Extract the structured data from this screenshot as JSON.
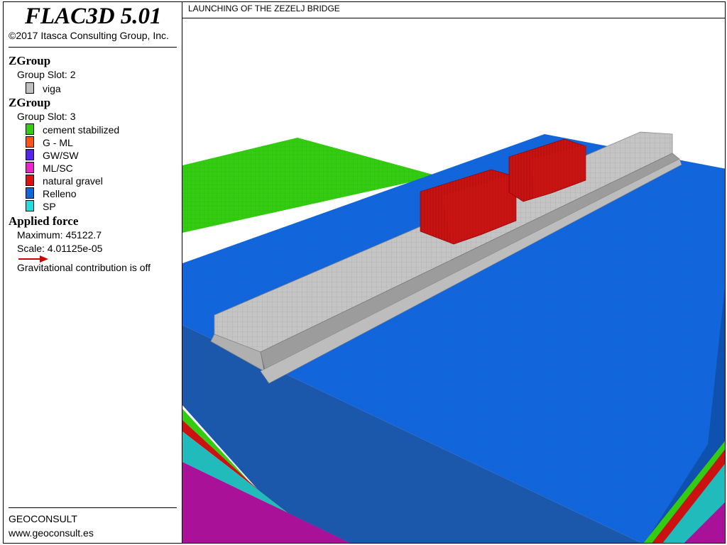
{
  "header": {
    "app_title": "FLAC3D 5.01",
    "copyright": "©2017 Itasca Consulting Group, Inc."
  },
  "legend": {
    "group1": {
      "heading": "ZGroup",
      "slot": "Group Slot: 2",
      "items": [
        {
          "label": "viga",
          "color": "#c0c0c0"
        }
      ]
    },
    "group2": {
      "heading": "ZGroup",
      "slot": "Group Slot: 3",
      "items": [
        {
          "label": "cement stabilized",
          "color": "#33cc11"
        },
        {
          "label": "G - ML",
          "color": "#ff5511"
        },
        {
          "label": "GW/SW",
          "color": "#5522ee"
        },
        {
          "label": "ML/SC",
          "color": "#ee22cc"
        },
        {
          "label": "natural gravel",
          "color": "#dd1111"
        },
        {
          "label": "Relleno",
          "color": "#1166dd"
        },
        {
          "label": "SP",
          "color": "#22dddd"
        }
      ]
    },
    "force": {
      "heading": "Applied force",
      "maximum": "Maximum: 45122.7",
      "scale": "Scale: 4.01125e-05",
      "note": "Gravitational contribution is off",
      "arrow_color": "#cc0000"
    }
  },
  "viewport": {
    "title": "LAUNCHING OF THE ZEZELJ BRIDGE"
  },
  "footer": {
    "company": "GEOCONSULT",
    "website": "www.geoconsult.es"
  }
}
